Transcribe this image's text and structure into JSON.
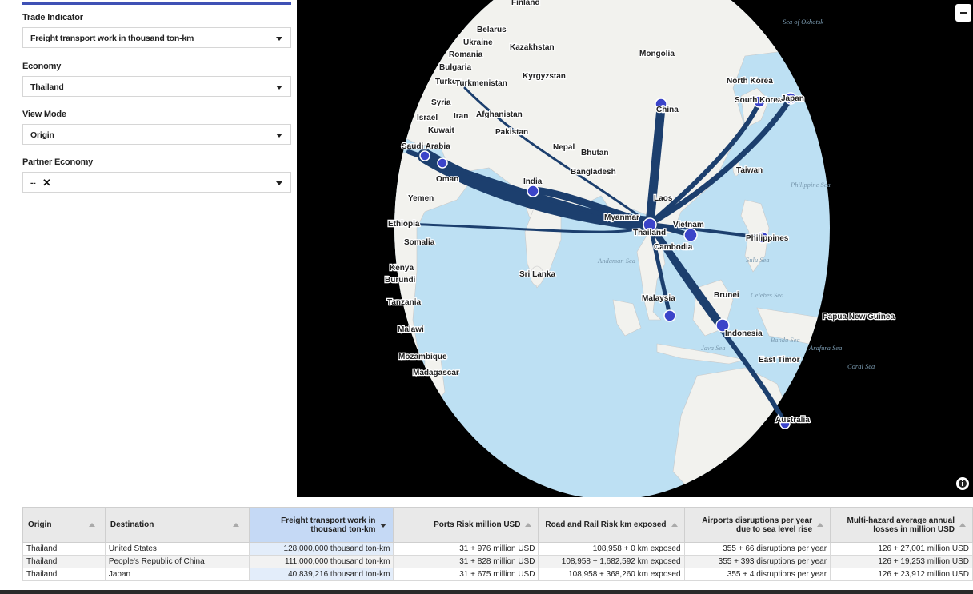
{
  "filters": {
    "trade_indicator": {
      "label": "Trade Indicator",
      "value": "Freight transport work in thousand ton-km"
    },
    "economy": {
      "label": "Economy",
      "value": "Thailand"
    },
    "view_mode": {
      "label": "View Mode",
      "value": "Origin"
    },
    "partner_economy": {
      "label": "Partner Economy",
      "value": "--"
    }
  },
  "map": {
    "country_labels": [
      "Finland",
      "Belarus",
      "Ukraine",
      "Romania",
      "Bulgaria",
      "Kazakhstan",
      "Mongolia",
      "Turkey",
      "Turkmenistan",
      "Kyrgyzstan",
      "North Korea",
      "Syria",
      "Israel",
      "Iran",
      "Afghanistan",
      "South Korea",
      "Japan",
      "China",
      "Kuwait",
      "Pakistan",
      "Saudi Arabia",
      "Nepal",
      "Bhutan",
      "Oman",
      "Bangladesh",
      "Taiwan",
      "India",
      "Yemen",
      "Laos",
      "Myanmar",
      "Vietnam",
      "Ethiopia",
      "Thailand",
      "Philippines",
      "Somalia",
      "Cambodia",
      "Kenya",
      "Sri Lanka",
      "Burundi",
      "Malaysia",
      "Brunei",
      "Tanzania",
      "Papua New Guinea",
      "Malawi",
      "Indonesia",
      "Mozambique",
      "East Timor",
      "Madagascar",
      "Australia"
    ],
    "sea_labels": [
      "Sea of Okhotsk",
      "Philippine Sea",
      "Andaman Sea",
      "Sulu Sea",
      "Celebes Sea",
      "Banda Sea",
      "Java Sea",
      "Arafura Sea",
      "Coral Sea"
    ],
    "zoom_out_icon": "minus-icon",
    "info_icon": "info-icon"
  },
  "table": {
    "columns": [
      {
        "label": "Origin",
        "sort": "none"
      },
      {
        "label": "Destination",
        "sort": "none"
      },
      {
        "label": "Freight transport work in thousand ton-km",
        "sort": "desc"
      },
      {
        "label": "Ports Risk million USD",
        "sort": "none"
      },
      {
        "label": "Road and Rail Risk km exposed",
        "sort": "none"
      },
      {
        "label": "Airports disruptions per year due to sea level rise",
        "sort": "none"
      },
      {
        "label": "Multi-hazard average annual losses in million USD",
        "sort": "none"
      }
    ],
    "rows": [
      [
        "Thailand",
        "United States",
        "128,000,000 thousand ton-km",
        "31 + 976 million USD",
        "108,958 + 0 km exposed",
        "355 + 66 disruptions per year",
        "126 + 27,001 million USD"
      ],
      [
        "Thailand",
        "People's Republic of China",
        "111,000,000 thousand ton-km",
        "31 + 828 million USD",
        "108,958 + 1,682,592 km exposed",
        "355 + 393 disruptions per year",
        "126 + 19,253 million USD"
      ],
      [
        "Thailand",
        "Japan",
        "40,839,216 thousand ton-km",
        "31 + 675 million USD",
        "108,958 + 368,260 km exposed",
        "355 + 4 disruptions per year",
        "126 + 23,912 million USD"
      ]
    ]
  },
  "colors": {
    "accent": "#3f51b5",
    "flow": "#1c3f6e",
    "node": "#3b44c9",
    "ocean": "#bde0f3",
    "land": "#f2f2ee"
  }
}
